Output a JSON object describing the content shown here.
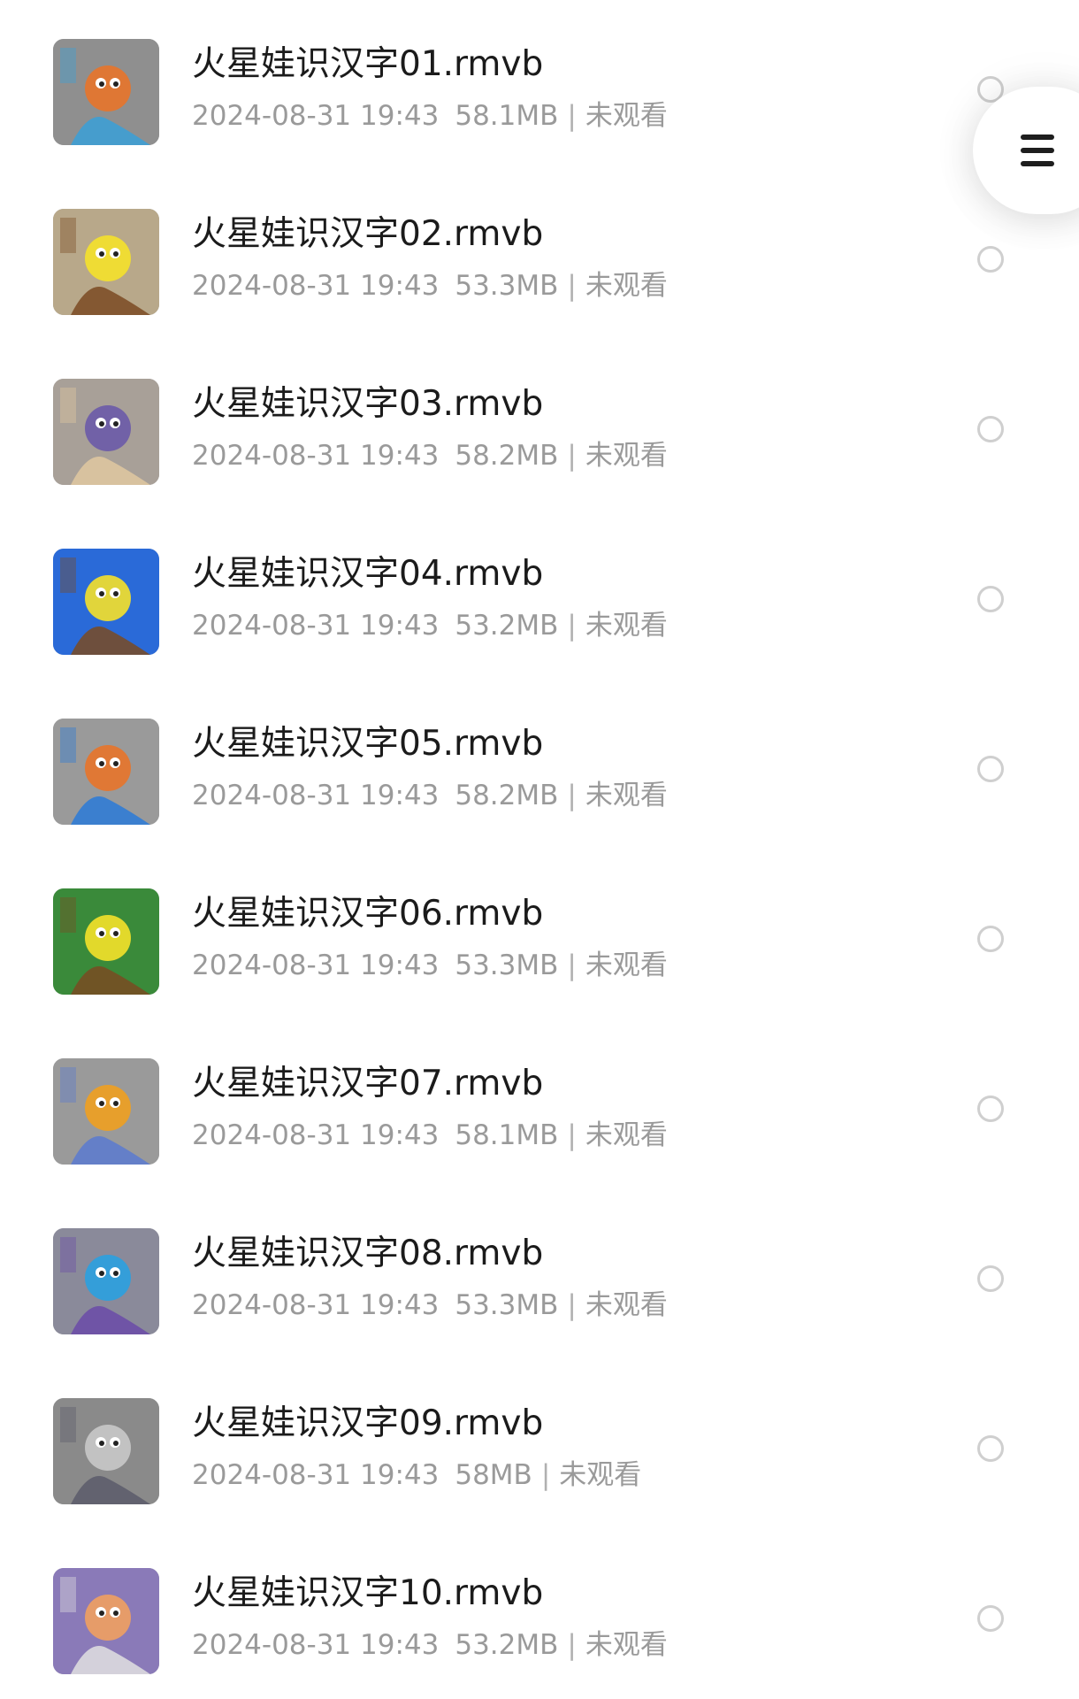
{
  "files": [
    {
      "title": "火星娃识汉字01.rmvb",
      "date": "2024-08-31 19:43",
      "size": "58.1MB",
      "status": "未观看",
      "thumb": {
        "bg": "#8f8f8f",
        "accent": "#e8742a",
        "accent2": "#3aa0d8"
      }
    },
    {
      "title": "火星娃识汉字02.rmvb",
      "date": "2024-08-31 19:43",
      "size": "53.3MB",
      "status": "未观看",
      "thumb": {
        "bg": "#b8a88a",
        "accent": "#f5e12a",
        "accent2": "#7a4a22"
      }
    },
    {
      "title": "火星娃识汉字03.rmvb",
      "date": "2024-08-31 19:43",
      "size": "58.2MB",
      "status": "未观看",
      "thumb": {
        "bg": "#a8a098",
        "accent": "#6a5aa8",
        "accent2": "#e0c8a0"
      }
    },
    {
      "title": "火星娃识汉字04.rmvb",
      "date": "2024-08-31 19:43",
      "size": "53.2MB",
      "status": "未观看",
      "thumb": {
        "bg": "#2a6ad8",
        "accent": "#f5e12a",
        "accent2": "#7a4a22"
      }
    },
    {
      "title": "火星娃识汉字05.rmvb",
      "date": "2024-08-31 19:43",
      "size": "58.2MB",
      "status": "未观看",
      "thumb": {
        "bg": "#9a9a9a",
        "accent": "#e8742a",
        "accent2": "#2a7ad8"
      }
    },
    {
      "title": "火星娃识汉字06.rmvb",
      "date": "2024-08-31 19:43",
      "size": "53.3MB",
      "status": "未观看",
      "thumb": {
        "bg": "#3a8a3a",
        "accent": "#f5e12a",
        "accent2": "#7a4a22"
      }
    },
    {
      "title": "火星娃识汉字07.rmvb",
      "date": "2024-08-31 19:43",
      "size": "58.1MB",
      "status": "未观看",
      "thumb": {
        "bg": "#9a9a9a",
        "accent": "#f0a020",
        "accent2": "#5a7ad0"
      }
    },
    {
      "title": "火星娃识汉字08.rmvb",
      "date": "2024-08-31 19:43",
      "size": "53.3MB",
      "status": "未观看",
      "thumb": {
        "bg": "#8a8a9a",
        "accent": "#2aa0e0",
        "accent2": "#6a4aa8"
      }
    },
    {
      "title": "火星娃识汉字09.rmvb",
      "date": "2024-08-31 19:43",
      "size": "58MB",
      "status": "未观看",
      "thumb": {
        "bg": "#8a8a8a",
        "accent": "#c8c8c8",
        "accent2": "#5a5a6a"
      }
    },
    {
      "title": "火星娃识汉字10.rmvb",
      "date": "2024-08-31 19:43",
      "size": "53.2MB",
      "status": "未观看",
      "thumb": {
        "bg": "#8a7ab8",
        "accent": "#f0a060",
        "accent2": "#e0e0e0"
      }
    }
  ],
  "fab": {
    "icon": "menu-icon"
  }
}
